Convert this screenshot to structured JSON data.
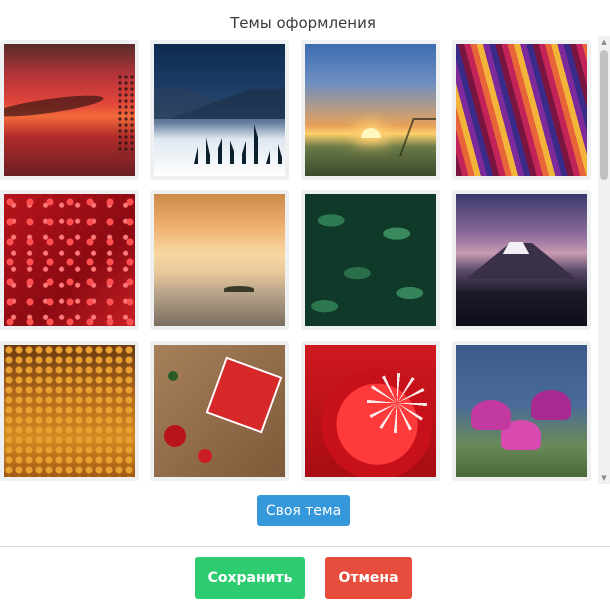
{
  "dialog": {
    "title": "Темы оформления",
    "custom_theme_label": "Своя тема",
    "save_label": "Сохранить",
    "cancel_label": "Отмена"
  },
  "themes": [
    {
      "name": "sunset-red-sky"
    },
    {
      "name": "winter-mountains-night"
    },
    {
      "name": "sunrise-field"
    },
    {
      "name": "colorful-ribbons"
    },
    {
      "name": "red-hearts-bokeh"
    },
    {
      "name": "misty-beach-dawn"
    },
    {
      "name": "green-leaves"
    },
    {
      "name": "fuji-mountain-dusk"
    },
    {
      "name": "autumn-forest"
    },
    {
      "name": "christmas-gifts"
    },
    {
      "name": "red-christmas-ornament"
    },
    {
      "name": "purple-tulips"
    }
  ],
  "colors": {
    "primary": "#3498db",
    "success": "#2ecc71",
    "danger": "#e74c3c"
  }
}
